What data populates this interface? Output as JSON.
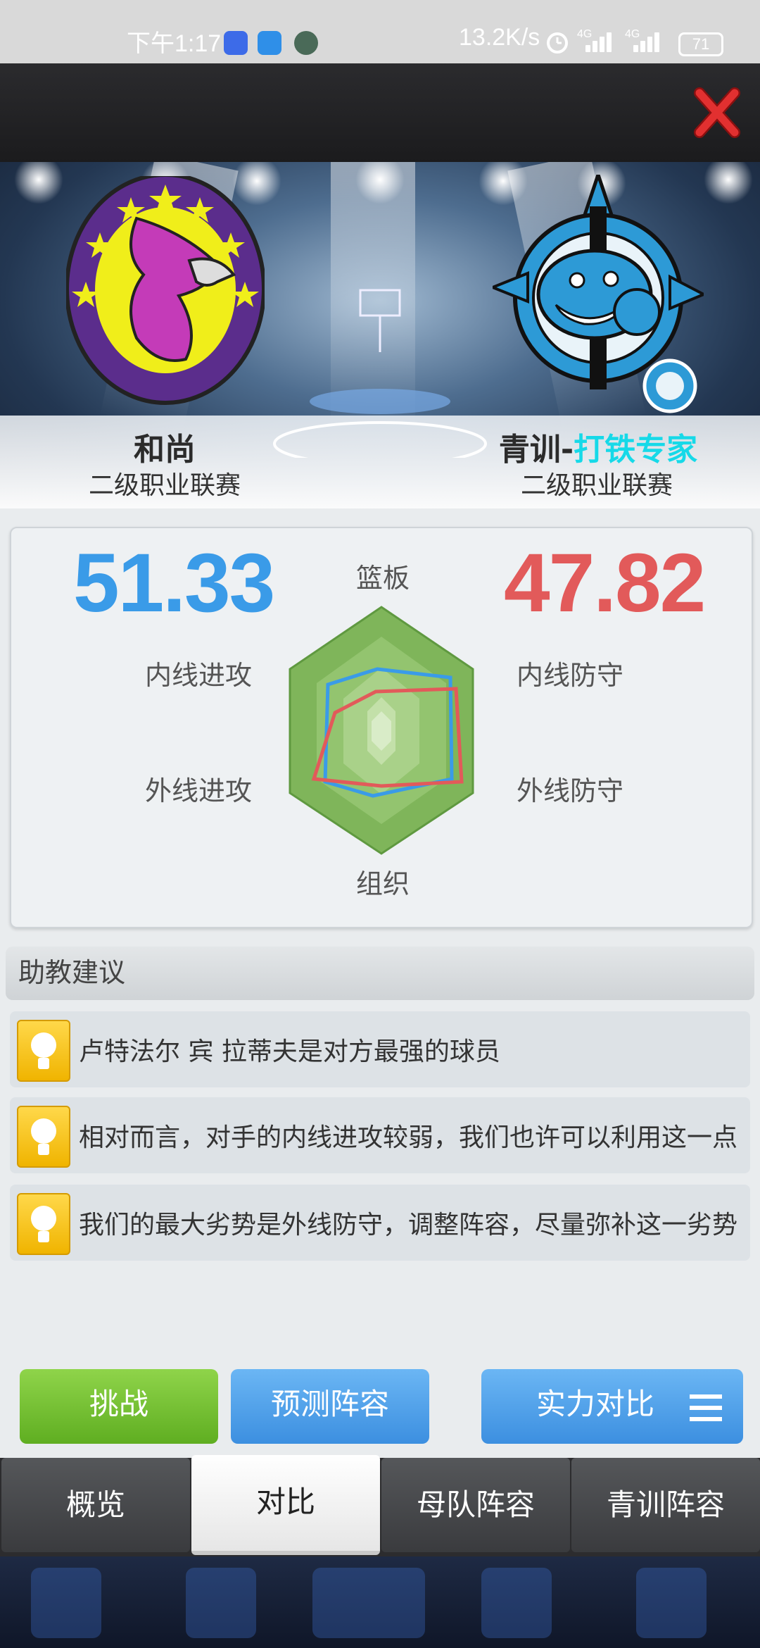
{
  "status_bar": {
    "time": "下午1:17",
    "speed": "13.2K/s",
    "network1": "4G",
    "network2": "4G",
    "battery": "71"
  },
  "teams": {
    "home": {
      "name": "和尚",
      "league": "二级职业联赛"
    },
    "away": {
      "name_prefix": "青训-",
      "name_highlight": "打铁专家",
      "league": "二级职业联赛"
    }
  },
  "comparison": {
    "home_score": "51.33",
    "away_score": "47.82",
    "axes": {
      "top": "篮板",
      "left_upper": "内线进攻",
      "left_lower": "外线进攻",
      "right_upper": "内线防守",
      "right_lower": "外线防守",
      "bottom": "组织"
    },
    "colors": {
      "home": "#3a9be8",
      "away": "#e25a5a"
    }
  },
  "advice": {
    "title": "助教建议",
    "items": [
      "卢特法尔 宾 拉蒂夫是对方最强的球员",
      "相对而言，对手的内线进攻较弱，我们也许可以利用这一点",
      "我们的最大劣势是外线防守，调整阵容，尽量弥补这一劣势"
    ]
  },
  "buttons": {
    "challenge": "挑战",
    "predict": "预测阵容",
    "compare": "实力对比"
  },
  "tabs": [
    "概览",
    "对比",
    "母队阵容",
    "青训阵容"
  ],
  "active_tab": "对比"
}
